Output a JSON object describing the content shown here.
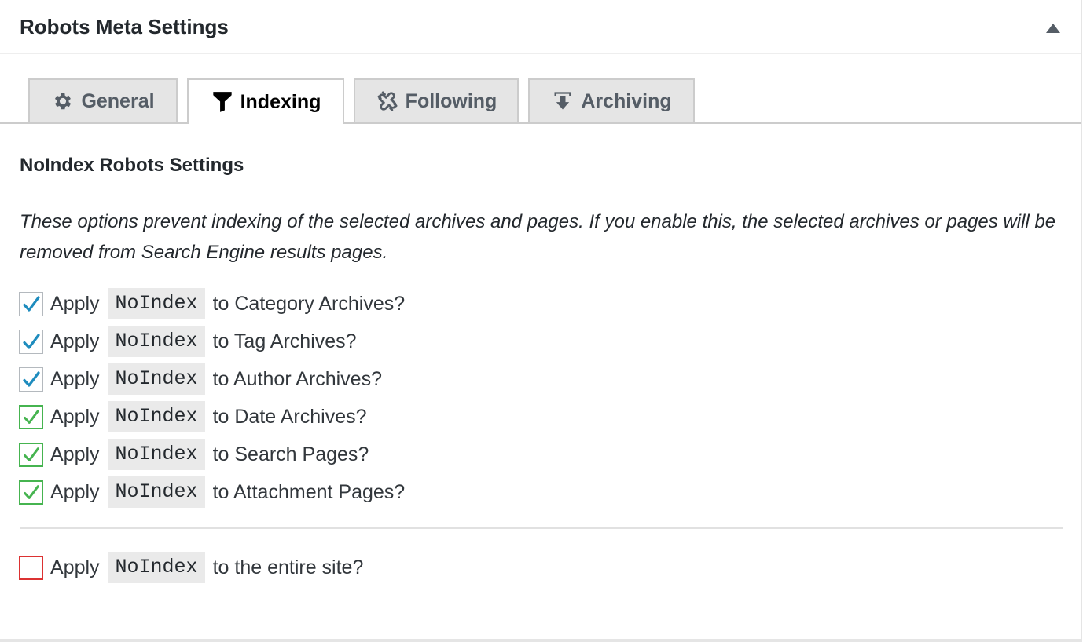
{
  "panel": {
    "title": "Robots Meta Settings",
    "collapse_icon": "triangle-up-icon"
  },
  "tabs": [
    {
      "label": "General",
      "icon": "gear-icon",
      "active": false
    },
    {
      "label": "Indexing",
      "icon": "funnel-icon",
      "active": true
    },
    {
      "label": "Following",
      "icon": "unlink-icon",
      "active": false
    },
    {
      "label": "Archiving",
      "icon": "download-icon",
      "active": false
    }
  ],
  "section": {
    "title": "NoIndex Robots Settings",
    "description": "These options prevent indexing of the selected archives and pages. If you enable this, the selected archives or pages will be removed from Search Engine results pages."
  },
  "options": [
    {
      "prefix": "Apply",
      "code": "NoIndex",
      "suffix": "to Category Archives?",
      "checked": true,
      "check_color": "#1e8cbe"
    },
    {
      "prefix": "Apply",
      "code": "NoIndex",
      "suffix": "to Tag Archives?",
      "checked": true,
      "check_color": "#1e8cbe"
    },
    {
      "prefix": "Apply",
      "code": "NoIndex",
      "suffix": "to Author Archives?",
      "checked": true,
      "check_color": "#1e8cbe"
    },
    {
      "prefix": "Apply",
      "code": "NoIndex",
      "suffix": "to Date Archives?",
      "checked": true,
      "check_color": "#46b450"
    },
    {
      "prefix": "Apply",
      "code": "NoIndex",
      "suffix": "to Search Pages?",
      "checked": true,
      "check_color": "#46b450"
    },
    {
      "prefix": "Apply",
      "code": "NoIndex",
      "suffix": "to Attachment Pages?",
      "checked": true,
      "check_color": "#46b450"
    }
  ],
  "site_option": {
    "prefix": "Apply",
    "code": "NoIndex",
    "suffix": "to the entire site?",
    "checked": false,
    "border_color": "#dc3232"
  }
}
